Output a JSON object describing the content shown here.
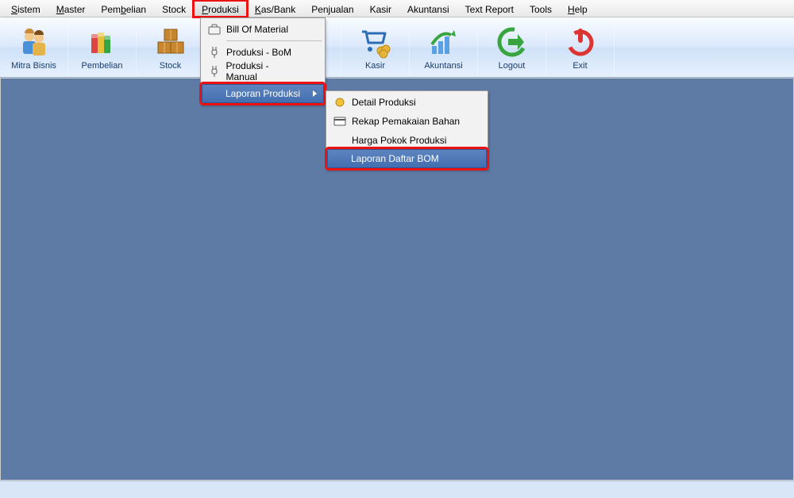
{
  "menubar": {
    "items": [
      {
        "label": "Sistem",
        "accel": 0
      },
      {
        "label": "Master",
        "accel": 0
      },
      {
        "label": "Pembelian",
        "accel": 3
      },
      {
        "label": "Stock"
      },
      {
        "label": "Produksi",
        "accel": 0,
        "highlighted": true
      },
      {
        "label": "Kas/Bank",
        "accel": 0
      },
      {
        "label": "Penjualan"
      },
      {
        "label": "Kasir"
      },
      {
        "label": "Akuntansi"
      },
      {
        "label": "Text Report"
      },
      {
        "label": "Tools"
      },
      {
        "label": "Help",
        "accel": 0
      }
    ]
  },
  "toolbar": {
    "items": [
      {
        "label": "Mitra Bisnis",
        "icon": "people-icon"
      },
      {
        "label": "Pembelian",
        "icon": "books-icon"
      },
      {
        "label": "Stock",
        "icon": "boxes-icon"
      },
      {
        "label": "",
        "icon": ""
      },
      {
        "label": "",
        "icon": ""
      },
      {
        "label": "Kasir",
        "icon": "cart-coins-icon"
      },
      {
        "label": "Akuntansi",
        "icon": "chart-arrow-icon"
      },
      {
        "label": "Logout",
        "icon": "logout-icon"
      },
      {
        "label": "Exit",
        "icon": "power-icon"
      }
    ]
  },
  "dropdown_produksi": {
    "items": [
      {
        "label": "Bill Of Material",
        "icon": "briefcase-icon"
      },
      {
        "sep": true
      },
      {
        "label": "Produksi - BoM",
        "icon": "plug-icon"
      },
      {
        "label": "Produksi - Manual",
        "icon": "plug-icon"
      },
      {
        "sep": true
      },
      {
        "label": "Laporan Produksi",
        "highlighted": true,
        "redbox": true,
        "hasArrow": true
      }
    ]
  },
  "dropdown_laporan": {
    "items": [
      {
        "label": "Detail Produksi",
        "icon": "asterisk-icon"
      },
      {
        "label": "Rekap Pemakaian Bahan",
        "icon": "card-icon"
      },
      {
        "label": "Harga Pokok Produksi"
      },
      {
        "label": "Laporan Daftar BOM",
        "highlighted": true,
        "redbox": true
      }
    ]
  }
}
